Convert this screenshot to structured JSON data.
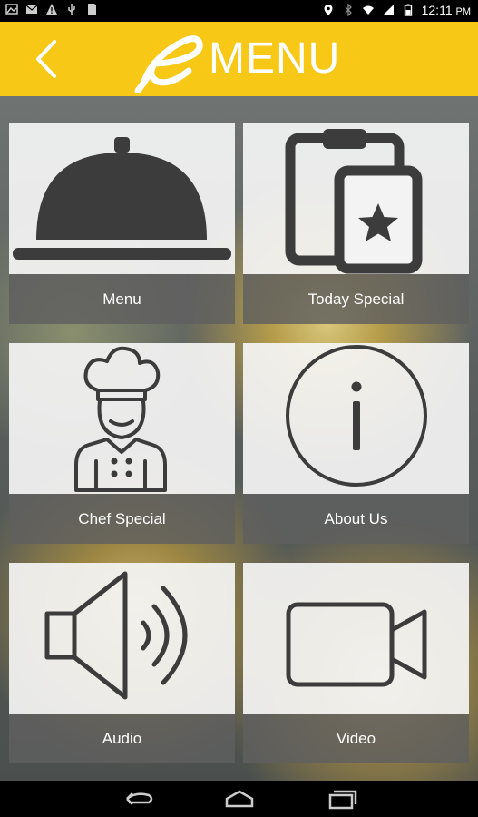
{
  "status_bar": {
    "time": "12:11",
    "time_suffix": "PM"
  },
  "header": {
    "logo_text": "MENU",
    "back_icon": "chevron-left-icon",
    "brand_color": "#f7c815"
  },
  "tiles": [
    {
      "label": "Menu",
      "icon": "cloche-icon"
    },
    {
      "label": "Today Special",
      "icon": "clipboard-star-icon"
    },
    {
      "label": "Chef Special",
      "icon": "chef-icon"
    },
    {
      "label": "About Us",
      "icon": "info-icon"
    },
    {
      "label": "Audio",
      "icon": "speaker-icon"
    },
    {
      "label": "Video",
      "icon": "video-camera-icon"
    }
  ],
  "nav_bar": {
    "back": "back-icon",
    "home": "home-icon",
    "recents": "recents-icon"
  }
}
